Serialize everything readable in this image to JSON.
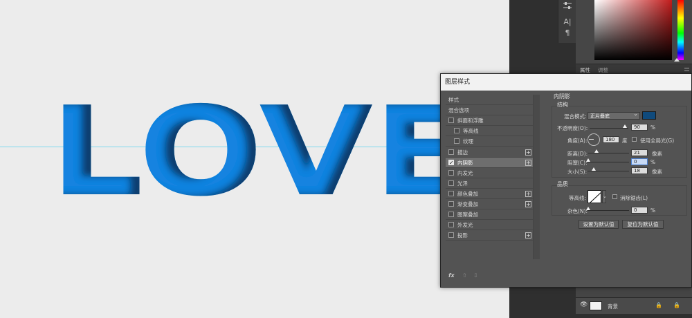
{
  "canvas": {
    "text": "LOVE",
    "text_color": "#1583e0",
    "guide_color": "#7fd8ee"
  },
  "tools": {
    "sliders_icon": "sliders-icon",
    "char_icon": "A|",
    "para_icon": "¶"
  },
  "panel": {
    "tabs": [
      "属性",
      "调整"
    ]
  },
  "layers": {
    "bottom_layer_name": "背景"
  },
  "dialog": {
    "title": "图层样式",
    "styles": [
      {
        "label": "样式",
        "checkbox": false,
        "checked": false,
        "plus": false,
        "indent": 0,
        "selected": false
      },
      {
        "label": "混合选项",
        "checkbox": false,
        "checked": false,
        "plus": false,
        "indent": 0,
        "selected": false
      },
      {
        "label": "斜面和浮雕",
        "checkbox": true,
        "checked": false,
        "plus": false,
        "indent": 0,
        "selected": false
      },
      {
        "label": "等高线",
        "checkbox": true,
        "checked": false,
        "plus": false,
        "indent": 1,
        "selected": false
      },
      {
        "label": "纹理",
        "checkbox": true,
        "checked": false,
        "plus": false,
        "indent": 1,
        "selected": false
      },
      {
        "label": "描边",
        "checkbox": true,
        "checked": false,
        "plus": true,
        "indent": 0,
        "selected": false
      },
      {
        "label": "内阴影",
        "checkbox": true,
        "checked": true,
        "plus": true,
        "indent": 0,
        "selected": true
      },
      {
        "label": "内发光",
        "checkbox": true,
        "checked": false,
        "plus": false,
        "indent": 0,
        "selected": false
      },
      {
        "label": "光泽",
        "checkbox": true,
        "checked": false,
        "plus": false,
        "indent": 0,
        "selected": false
      },
      {
        "label": "颜色叠加",
        "checkbox": true,
        "checked": false,
        "plus": true,
        "indent": 0,
        "selected": false
      },
      {
        "label": "渐变叠加",
        "checkbox": true,
        "checked": false,
        "plus": true,
        "indent": 0,
        "selected": false
      },
      {
        "label": "图案叠加",
        "checkbox": true,
        "checked": false,
        "plus": false,
        "indent": 0,
        "selected": false
      },
      {
        "label": "外发光",
        "checkbox": true,
        "checked": false,
        "plus": false,
        "indent": 0,
        "selected": false
      },
      {
        "label": "投影",
        "checkbox": true,
        "checked": false,
        "plus": true,
        "indent": 0,
        "selected": false
      }
    ],
    "footer_icons": [
      "fx",
      "⇧",
      "⇩"
    ],
    "inner_shadow": {
      "title": "内阴影",
      "structure_title": "结构",
      "blend_mode_label": "混合模式:",
      "blend_mode_value": "正片叠底",
      "shadow_color": "#0f4a7c",
      "opacity_label": "不透明度(O):",
      "opacity_value": "90",
      "opacity_unit": "%",
      "angle_label": "角度(A):",
      "angle_value": "180",
      "angle_unit": "度",
      "global_light_label": "使用全局光(G)",
      "distance_label": "距离(D):",
      "distance_value": "21",
      "distance_unit": "像素",
      "choke_label": "阻塞(C):",
      "choke_value": "0",
      "choke_unit": "%",
      "size_label": "大小(S):",
      "size_value": "18",
      "size_unit": "像素",
      "quality_title": "品质",
      "contour_label": "等高线:",
      "antialias_label": "消除锯齿(L)",
      "noise_label": "杂色(N):",
      "noise_value": "0",
      "noise_unit": "%",
      "default_button": "设置为默认值",
      "reset_button": "复位为默认值"
    }
  }
}
